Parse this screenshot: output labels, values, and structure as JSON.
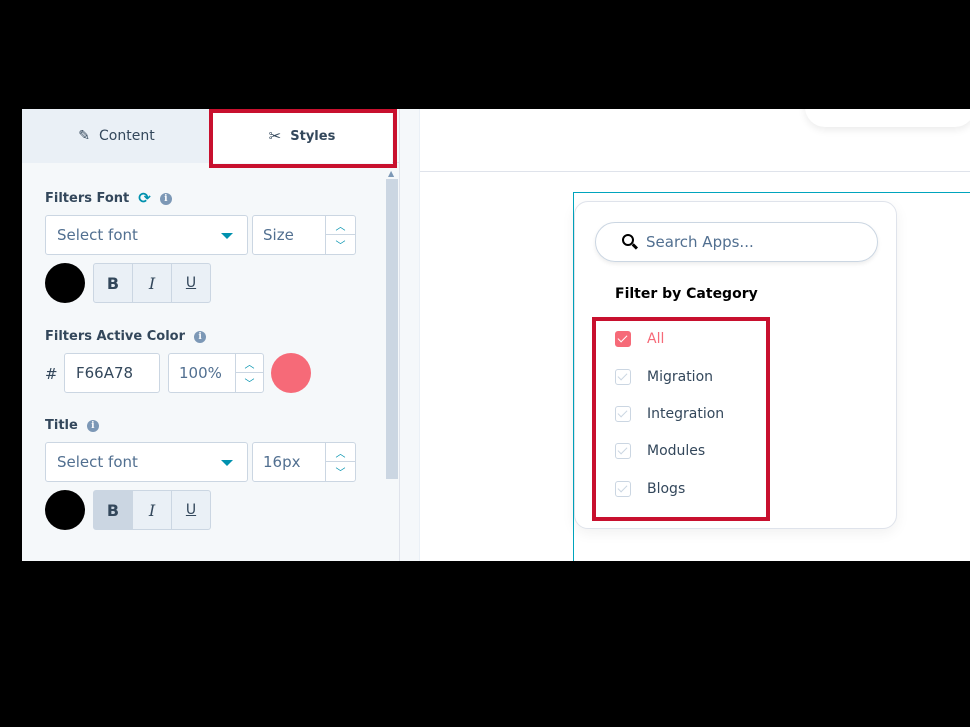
{
  "panel": {
    "tabs": {
      "content": "Content",
      "styles": "Styles"
    },
    "filters_font": {
      "label": "Filters Font",
      "font_placeholder": "Select font",
      "size_placeholder": "Size",
      "color": "#000000",
      "bold": "B",
      "italic": "I",
      "underline": "U"
    },
    "active_color": {
      "label": "Filters Active Color",
      "hash": "#",
      "hex": "F66A78",
      "opacity": "100%",
      "swatch": "#F66A78"
    },
    "title": {
      "label": "Title",
      "font_placeholder": "Select font",
      "size": "16px",
      "color": "#000000",
      "bold": "B",
      "italic": "I",
      "underline": "U"
    }
  },
  "preview": {
    "search_placeholder": "Search Apps...",
    "filter_title": "Filter by Category",
    "categories": [
      {
        "label": "All",
        "checked": true
      },
      {
        "label": "Migration",
        "checked": false
      },
      {
        "label": "Integration",
        "checked": false
      },
      {
        "label": "Modules",
        "checked": false
      },
      {
        "label": "Blogs",
        "checked": false
      }
    ]
  },
  "colors": {
    "accent": "#F66A78",
    "highlight": "#C8102E",
    "link": "#0091AE"
  }
}
